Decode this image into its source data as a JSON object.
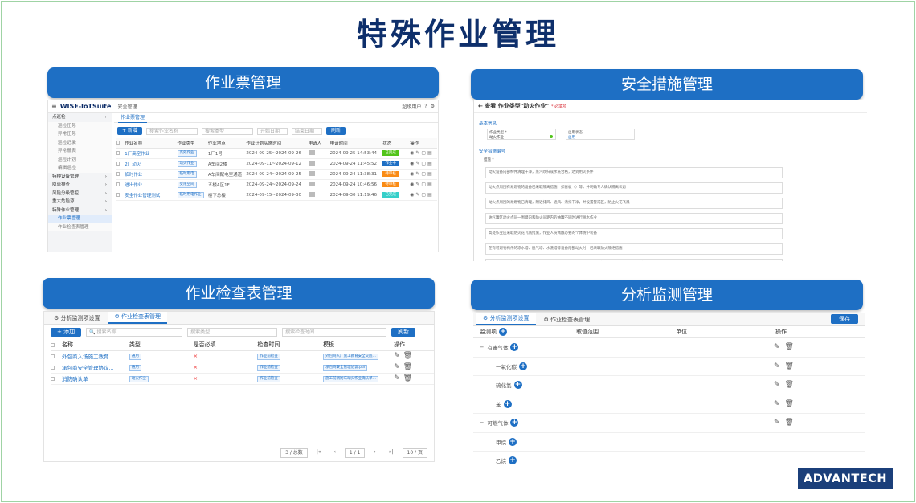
{
  "title": "特殊作业管理",
  "banners": {
    "ticket": "作业票管理",
    "safety": "安全措施管理",
    "checklist": "作业检查表管理",
    "monitor": "分析监测管理"
  },
  "ticket_panel": {
    "logo": "WISE-IoTSuite",
    "tenant": "安全管理",
    "user": "超级用户",
    "sidebar": [
      {
        "label": "点巡检",
        "type": "group"
      },
      {
        "label": "巡检任务",
        "type": "sub"
      },
      {
        "label": "异常任务",
        "type": "sub"
      },
      {
        "label": "巡检记录",
        "type": "sub"
      },
      {
        "label": "异常报表",
        "type": "sub"
      },
      {
        "label": "巡检计划",
        "type": "sub"
      },
      {
        "label": "编辑巡检",
        "type": "sub"
      },
      {
        "label": "特种设备管理",
        "type": "group"
      },
      {
        "label": "隐患排查",
        "type": "group"
      },
      {
        "label": "风险分级管控",
        "type": "group"
      },
      {
        "label": "重大危险源",
        "type": "group"
      },
      {
        "label": "特殊作业管理",
        "type": "group"
      },
      {
        "label": "作业票管理",
        "type": "active"
      },
      {
        "label": "作业检查表管理",
        "type": "sub"
      }
    ],
    "tab": "作业票管理",
    "add_label": "+ 新增",
    "search_placeholder": "搜索作业名称",
    "type_placeholder": "搜索类型",
    "start_placeholder": "开始日期",
    "end_placeholder": "结束日期",
    "refresh_label": "刷新",
    "columns": [
      "作业名称",
      "作业类型",
      "作业地点",
      "作业计划实施时间",
      "申请人",
      "申请时间",
      "状态",
      "操作"
    ],
    "rows": [
      {
        "name": "1厂高空作业",
        "type": "高处作业",
        "place": "1厂1号",
        "plan": "2024-09-25~2024-09-26",
        "applicant": "",
        "time": "2024-09-25 14:53:44",
        "status": "已完成",
        "status_color": "#52c41a"
      },
      {
        "name": "2厂动火",
        "type": "动火作业",
        "place": "A车间2楼",
        "plan": "2024-09-11~2024-09-12",
        "applicant": "",
        "time": "2024-09-24 11:45:52",
        "status": "作业中",
        "status_color": "#1e6fc4"
      },
      {
        "name": "临时作业",
        "type": "临时用电",
        "place": "A车间配电室通道",
        "plan": "2024-09-24~2024-09-25",
        "applicant": "",
        "time": "2024-09-24 11:38:31",
        "status": "待审核",
        "status_color": "#fa8c16"
      },
      {
        "name": "进出作业",
        "type": "受限空间",
        "place": "五楼A区1F",
        "plan": "2024-09-24~2024-09-24",
        "applicant": "",
        "time": "2024-09-24 10:46:56",
        "status": "待审核",
        "status_color": "#fa8c16"
      },
      {
        "name": "安全作业管理测试",
        "type": "临时用电作业",
        "place": "楼下总楼",
        "plan": "2024-09-15~2024-09-30",
        "applicant": "",
        "time": "2024-09-30 11:19:46",
        "status": "已完成",
        "status_color": "#36cfc9"
      }
    ]
  },
  "safety_panel": {
    "back_title": "← 查看 作业类型\"动火作业\"",
    "warn": "* 必填项",
    "section_basic": "基本信息",
    "field_type_label": "作业类型 *",
    "field_type_value": "动火作业",
    "field_status_label": "启用状态",
    "field_status_value": "启用",
    "section_measures": "安全措施编号",
    "measures_label": "措施 *",
    "measures": [
      "动火设备内部构件清理干净，蒸汽吹扫或水洗合格，达到用火条件",
      "动火点周围有易燃物的设备已采取隔离措施，如盲板（）等，并明确专人确认隔离状态",
      "动火点周围的易燃物已清理，附近排风、通风、清扫干净，并设置警戒区，防止火花飞溅",
      "油气罐区动火点同一围堰内和防火间距内的油罐不同时进行脱水作业",
      "高处作业应采取防火花飞溅措施，作业人员佩戴必要的个体防护装备",
      "在有可燃物构件的凉水塔、脱气塔、水洗塔等设备内部动火时，已采取防火隔绝措施",
      "乙炔气瓶直立放置，已采取防倾倒措施并安装防回火装置；乙炔气瓶、氧气瓶与火源间的距离不应小于10m"
    ]
  },
  "checklist_panel": {
    "tab1": "分析监测项设置",
    "tab2": "作业检查表管理",
    "add_label": "+ 添加",
    "search_placeholder": "搜索名称",
    "type_placeholder": "搜索类型",
    "time_placeholder": "搜索检查时间",
    "refresh_label": "刷新",
    "columns": [
      "名称",
      "类型",
      "是否必填",
      "检查时间",
      "模板",
      "操作"
    ],
    "rows": [
      {
        "name": "外包商入场施工教育...",
        "type": "通用",
        "required": "×",
        "time": "作业前检查",
        "template": "外包商入厂施工教育安全交底..."
      },
      {
        "name": "承包商安全管理协议...",
        "type": "通用",
        "required": "×",
        "time": "作业前检查",
        "template": "承包商安全管理协议.pdf"
      },
      {
        "name": "消防确认单",
        "type": "动火作业",
        "required": "×",
        "time": "作业前检查",
        "template": "施工前消防与动火作业确认单..."
      }
    ],
    "pager_total": "3 / 总数",
    "pager_first": "|«",
    "pager_prev": "‹",
    "pager_page": "1 / 1",
    "pager_next": "›",
    "pager_last": "»|",
    "pager_size": "10 / 页"
  },
  "monitor_panel": {
    "tab1": "分析监测项设置",
    "tab2": "作业检查表管理",
    "save_label": "保存",
    "columns": [
      "监测项",
      "取值范围",
      "单位",
      "操作"
    ],
    "rows": [
      {
        "label": "有毒气体",
        "level": 0,
        "ops": true
      },
      {
        "label": "一氧化碳",
        "level": 1,
        "ops": true
      },
      {
        "label": "硫化氢",
        "level": 1,
        "ops": true
      },
      {
        "label": "苯",
        "level": 1,
        "ops": true
      },
      {
        "label": "可燃气体",
        "level": 0,
        "ops": true
      },
      {
        "label": "甲烷",
        "level": 1,
        "ops": false
      },
      {
        "label": "乙烷",
        "level": 1,
        "ops": false
      }
    ]
  },
  "brand": "ADVANTECH"
}
